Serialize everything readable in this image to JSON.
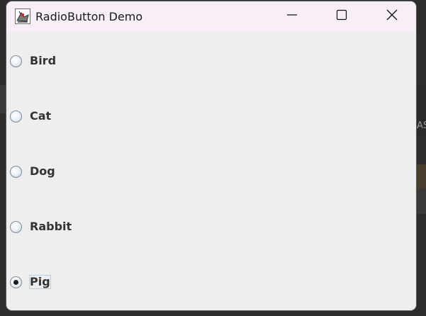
{
  "window": {
    "title": "RadioButton Demo",
    "app_icon": "java-duke-icon",
    "controls": {
      "minimize": "minimize-icon",
      "maximize": "maximize-icon",
      "close": "close-icon"
    }
  },
  "radio_group": {
    "selected": "Pig",
    "options": [
      {
        "label": "Bird",
        "checked": false
      },
      {
        "label": "Cat",
        "checked": false
      },
      {
        "label": "Dog",
        "checked": false
      },
      {
        "label": "Rabbit",
        "checked": false
      },
      {
        "label": "Pig",
        "checked": true
      }
    ]
  }
}
